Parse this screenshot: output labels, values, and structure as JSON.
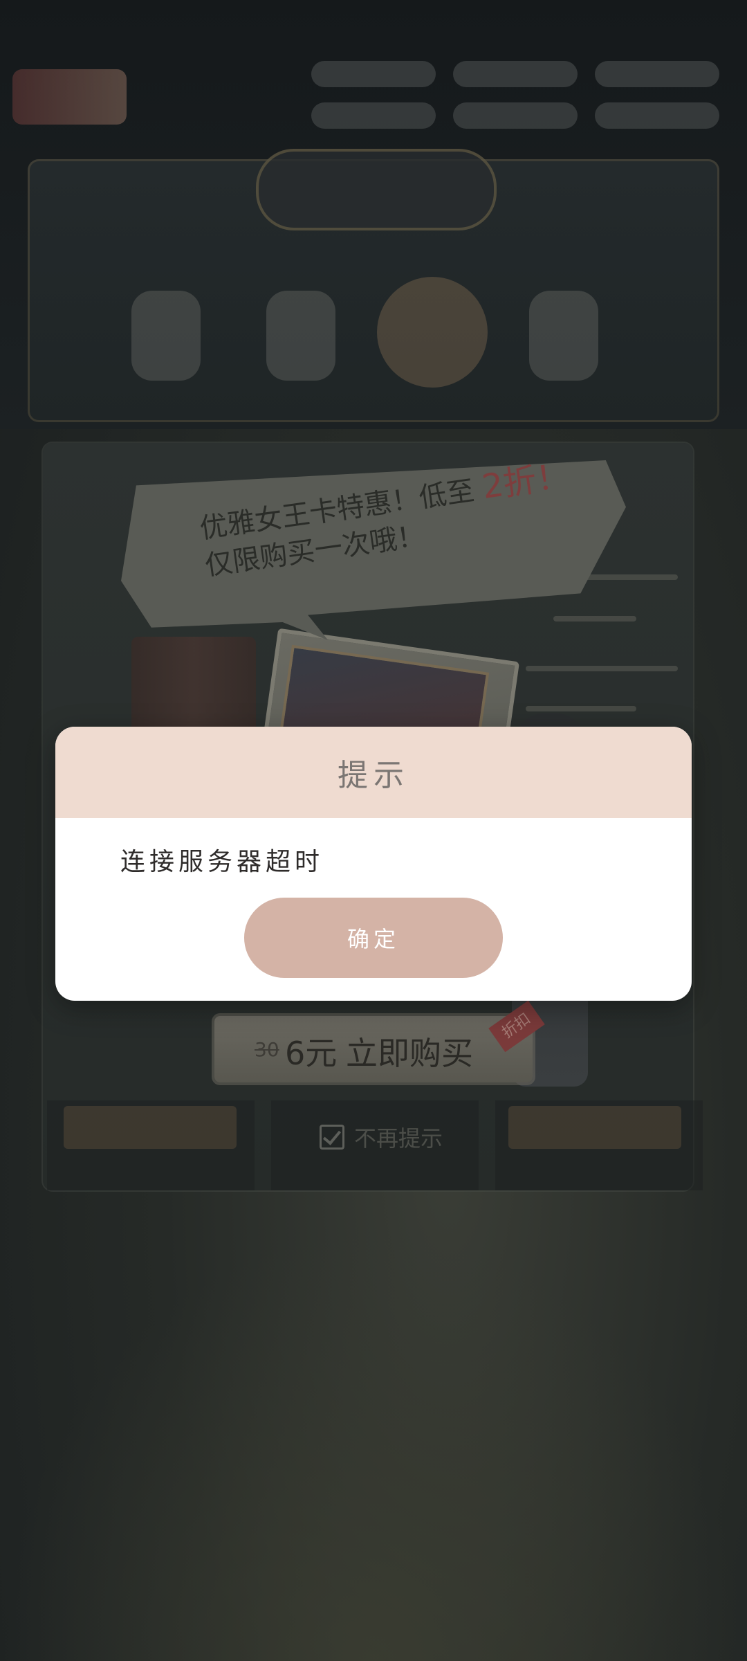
{
  "dialog": {
    "title": "提示",
    "message": "连接服务器超时",
    "ok_label": "确定"
  },
  "promo": {
    "line1_prefix": "优雅女王卡特惠！低至",
    "line1_highlight": "2折！",
    "line2": "仅限购买一次哦！"
  },
  "purchase": {
    "original_price": "30",
    "price": "6元",
    "action_label": "立即购买",
    "tag": "折扣"
  },
  "options": {
    "no_remind_label": "不再提示",
    "no_remind_checked": true
  },
  "colors": {
    "dialog_header": "#efdbd0",
    "ok_button": "#d4b3a6",
    "promo_highlight": "#7e3d3d"
  }
}
